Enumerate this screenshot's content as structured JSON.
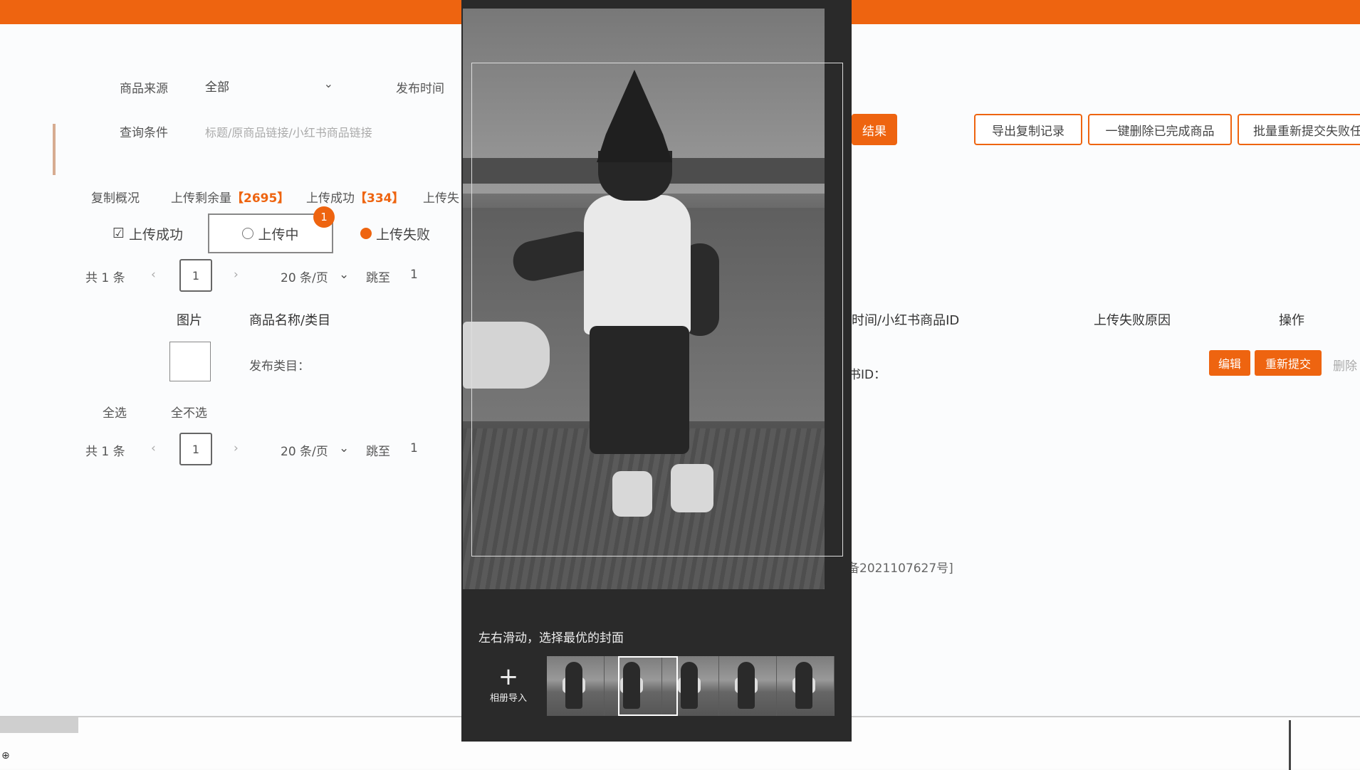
{
  "colors": {
    "accent": "#ee6410"
  },
  "filters": {
    "source_label": "商品来源",
    "source_value": "全部",
    "publish_time_label": "发布时间",
    "query_label": "查询条件",
    "query_placeholder": "标题/原商品链接/小红书商品链接",
    "search_button_fragment": "结果"
  },
  "actions": {
    "export": "导出复制记录",
    "delete_done": "一键删除已完成商品",
    "batch_resubmit": "批量重新提交失败任"
  },
  "summary": {
    "label": "复制概况",
    "remaining_label": "上传剩余量",
    "remaining_value": "【2695】",
    "success_label": "上传成功",
    "success_value": "【334】",
    "fail_label": "上传失"
  },
  "status_tabs": {
    "success": "上传成功",
    "uploading": "上传中",
    "failed": "上传失败",
    "badge": "1"
  },
  "pager_top": {
    "total": "共 1 条",
    "page": "1",
    "page_size": "20 条/页",
    "jump_label": "跳至",
    "jump_value": "1"
  },
  "pager_bottom": {
    "total": "共 1 条",
    "page": "1",
    "page_size": "20 条/页",
    "jump_label": "跳至",
    "jump_value": "1"
  },
  "table": {
    "col_image": "图片",
    "col_name": "商品名称/类目",
    "col_time": "时间/小红书商品ID",
    "col_reason": "上传失败原因",
    "col_ops": "操作",
    "row_category": "发布类目：",
    "row_xhs_id": "书ID：",
    "edit": "编辑",
    "resubmit": "重新提交",
    "delete_fragment": "删除"
  },
  "bulk": {
    "select_all": "全选",
    "select_none": "全不选"
  },
  "footer_fragment": "备2021107627号]",
  "cover_modal": {
    "hint": "左右滑动，选择最优的封面",
    "album_import": "相册导入",
    "album_icon": "plus-icon"
  }
}
